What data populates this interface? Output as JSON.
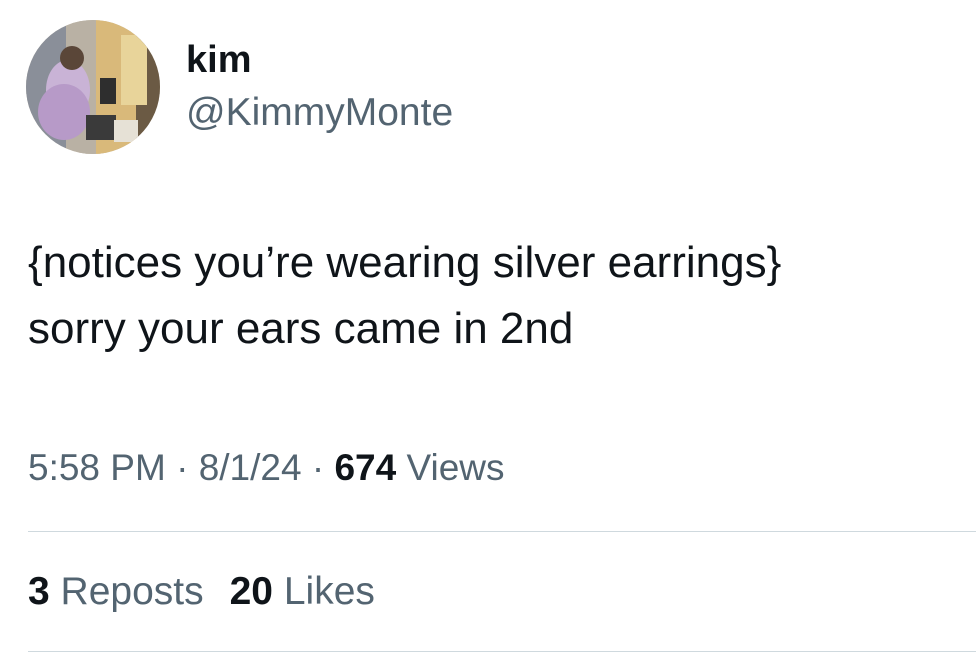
{
  "user": {
    "display_name": "kim",
    "handle": "@KimmyMonte"
  },
  "tweet": {
    "lines": [
      "{notices you’re wearing silver earrings}",
      "sorry your ears came in 2nd"
    ]
  },
  "meta": {
    "time": "5:58 PM",
    "separator": " · ",
    "date": "8/1/24",
    "views_count": "674",
    "views_label": " Views"
  },
  "stats": {
    "reposts_count": "3",
    "reposts_label": " Reposts",
    "likes_count": "20",
    "likes_label": " Likes"
  },
  "colors": {
    "text_primary": "#0f1419",
    "text_secondary": "#536471",
    "divider": "#cfd9de",
    "background": "#ffffff"
  }
}
